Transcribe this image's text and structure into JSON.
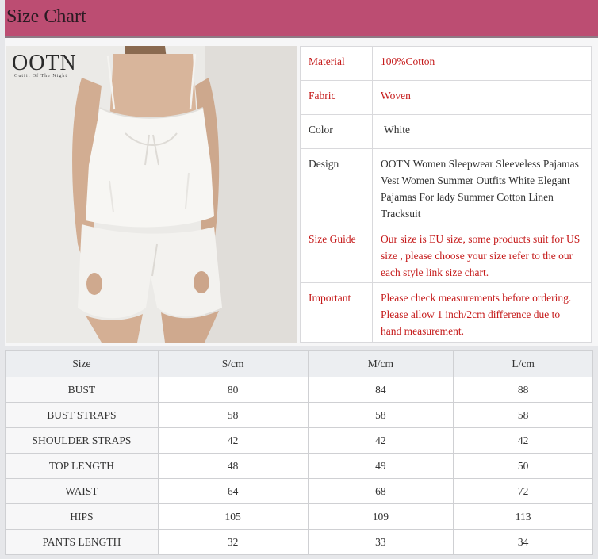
{
  "header": {
    "title": "Size Chart"
  },
  "logo": {
    "word": "OOTN",
    "tagline": "Outfit Of The Night"
  },
  "attributes": [
    {
      "key": "Material",
      "value": "100%Cotton",
      "highlight": true
    },
    {
      "key": "Fabric",
      "value": "Woven",
      "highlight": true
    },
    {
      "key": "Color",
      "value": "White",
      "highlight": false
    },
    {
      "key": "Design",
      "value": "OOTN Women Sleepwear Sleeveless Pajamas Vest Women Summer Outfits White Elegant Pajamas For lady Summer Cotton Linen Tracksuit",
      "highlight": false
    },
    {
      "key": "Size Guide",
      "value": "Our size is EU size, some products suit for US size , please choose your size refer to the our each style link size chart.",
      "highlight": true
    },
    {
      "key": "Important",
      "value": "Please check measurements before ordering. Please allow 1 inch/2cm difference due to hand measurement.",
      "highlight": true
    }
  ],
  "size_table": {
    "headers": [
      "Size",
      "S/cm",
      "M/cm",
      "L/cm"
    ],
    "rows": [
      {
        "label": "BUST",
        "values": [
          "80",
          "84",
          "88"
        ]
      },
      {
        "label": "BUST STRAPS",
        "values": [
          "58",
          "58",
          "58"
        ]
      },
      {
        "label": "SHOULDER STRAPS",
        "values": [
          "42",
          "42",
          "42"
        ]
      },
      {
        "label": "TOP LENGTH",
        "values": [
          "48",
          "49",
          "50"
        ]
      },
      {
        "label": "WAIST",
        "values": [
          "64",
          "68",
          "72"
        ]
      },
      {
        "label": "HIPS",
        "values": [
          "105",
          "109",
          "113"
        ]
      },
      {
        "label": "PANTS LENGTH",
        "values": [
          "32",
          "33",
          "34"
        ]
      }
    ]
  },
  "colors": {
    "header_bg": "#bc4d72",
    "highlight_text": "#c51a1a"
  }
}
